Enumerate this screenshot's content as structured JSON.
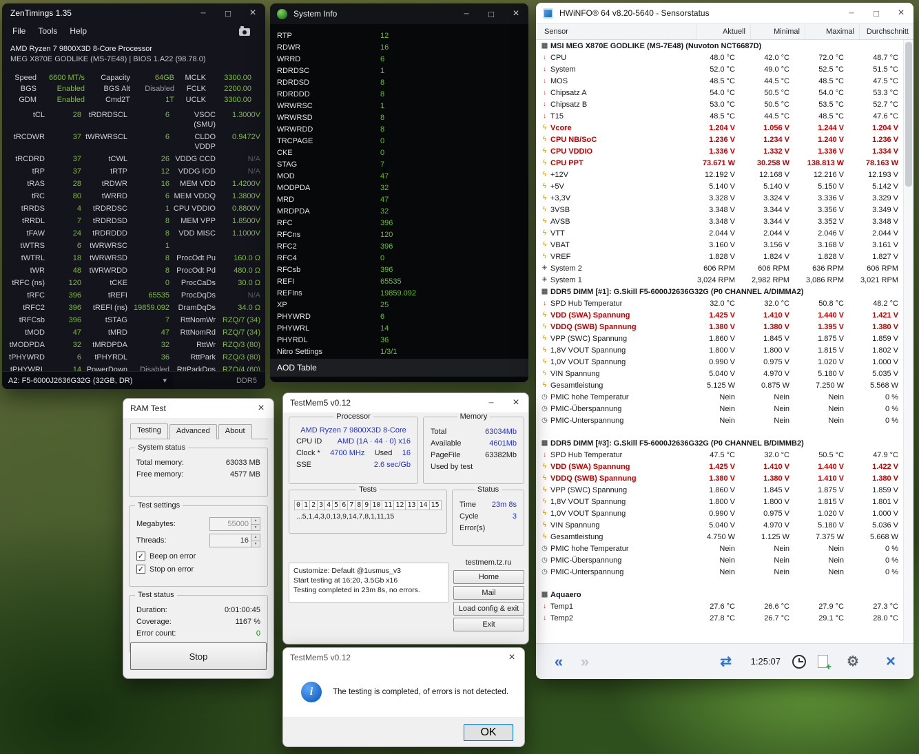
{
  "colors": {
    "zt_green": "#7dbf3a",
    "si_green": "#63c028",
    "tm_blue": "#2233cc"
  },
  "zentimings": {
    "title": "ZenTimings 1.35",
    "menu": [
      "File",
      "Tools",
      "Help"
    ],
    "cpu_line1": "AMD Ryzen 7 9800X3D 8-Core Processor",
    "board_line": "MEG X870E GODLIKE (MS-7E48) | BIOS 1.A22 (98.78.0)",
    "top_rows": [
      {
        "l1": "Speed",
        "v1": "6600 MT/s",
        "l2": "Capacity",
        "v2": "64GB",
        "l3": "MCLK",
        "v3": "3300.00"
      },
      {
        "l1": "BGS",
        "v1": "Enabled",
        "l2": "BGS Alt",
        "v2": "Disabled",
        "c2": "gray",
        "l3": "FCLK",
        "v3": "2200.00"
      },
      {
        "l1": "GDM",
        "v1": "Enabled",
        "l2": "Cmd2T",
        "v2": "1T",
        "l3": "UCLK",
        "v3": "3300.00"
      }
    ],
    "rows": [
      {
        "l1": "tCL",
        "v1": "28",
        "l2": "tRDRDSCL",
        "v2": "6",
        "l3": "VSOC (SMU)",
        "v3": "1.3000V"
      },
      {
        "l1": "tRCDWR",
        "v1": "37",
        "l2": "tWRWRSCL",
        "v2": "6",
        "l3": "CLDO VDDP",
        "v3": "0.9472V"
      },
      {
        "l1": "tRCDRD",
        "v1": "37",
        "l2": "tCWL",
        "v2": "26",
        "l3": "VDDG CCD",
        "v3": "N/A",
        "c3": "na"
      },
      {
        "l1": "tRP",
        "v1": "37",
        "l2": "tRTP",
        "v2": "12",
        "l3": "VDDG IOD",
        "v3": "N/A",
        "c3": "na"
      },
      {
        "l1": "tRAS",
        "v1": "28",
        "l2": "tRDWR",
        "v2": "16",
        "l3": "MEM VDD",
        "v3": "1.4200V"
      },
      {
        "l1": "tRC",
        "v1": "80",
        "l2": "tWRRD",
        "v2": "6",
        "l3": "MEM VDDQ",
        "v3": "1.3800V"
      },
      {
        "l1": "tRRDS",
        "v1": "4",
        "l2": "tRDRDSC",
        "v2": "1",
        "l3": "CPU VDDIO",
        "v3": "0.8800V"
      },
      {
        "l1": "tRRDL",
        "v1": "7",
        "l2": "tRDRDSD",
        "v2": "8",
        "l3": "MEM VPP",
        "v3": "1.8500V"
      },
      {
        "l1": "tFAW",
        "v1": "24",
        "l2": "tRDRDDD",
        "v2": "8",
        "l3": "VDD MISC",
        "v3": "1.1000V"
      },
      {
        "l1": "tWTRS",
        "v1": "6",
        "l2": "tWRWRSC",
        "v2": "1",
        "l3": "",
        "v3": ""
      },
      {
        "l1": "tWTRL",
        "v1": "18",
        "l2": "tWRWRSD",
        "v2": "8",
        "l3": "ProcOdt Pu",
        "v3": "160.0 Ω"
      },
      {
        "l1": "tWR",
        "v1": "48",
        "l2": "tWRWRDD",
        "v2": "8",
        "l3": "ProcOdt Pd",
        "v3": "480.0 Ω"
      },
      {
        "l1": "tRFC (ns)",
        "v1": "120",
        "l2": "tCKE",
        "v2": "0",
        "l3": "ProcCaDs",
        "v3": "30.0 Ω"
      },
      {
        "l1": "tRFC",
        "v1": "396",
        "l2": "tREFI",
        "v2": "65535",
        "l3": "ProcDqDs",
        "v3": "N/A",
        "c3": "na"
      },
      {
        "l1": "tRFC2",
        "v1": "396",
        "l2": "tREFI (ns)",
        "v2": "19859.092",
        "l3": "DramDqDs",
        "v3": "34.0 Ω"
      },
      {
        "l1": "tRFCsb",
        "v1": "396",
        "l2": "tSTAG",
        "v2": "7",
        "l3": "RttNomWr",
        "v3": "RZQ/7 (34)"
      },
      {
        "l1": "tMOD",
        "v1": "47",
        "l2": "tMRD",
        "v2": "47",
        "l3": "RttNomRd",
        "v3": "RZQ/7 (34)"
      },
      {
        "l1": "tMODPDA",
        "v1": "32",
        "l2": "tMRDPDA",
        "v2": "32",
        "l3": "RttWr",
        "v3": "RZQ/3 (80)"
      },
      {
        "l1": "tPHYWRD",
        "v1": "6",
        "l2": "tPHYRDL",
        "v2": "36",
        "l3": "RttPark",
        "v3": "RZQ/3 (80)"
      },
      {
        "l1": "tPHYWRL",
        "v1": "14",
        "l2": "PowerDown",
        "v2": "Disabled",
        "c2": "gray",
        "l3": "RttParkDqs",
        "v3": "RZQ/4 (60)"
      }
    ],
    "dimm_select": "A2: F5-6000J2636G32G (32GB, DR)",
    "mem_type": "DDR5"
  },
  "systeminfo": {
    "title": "System Info",
    "rows": [
      {
        "l": "RTP",
        "v": "12"
      },
      {
        "l": "RDWR",
        "v": "16"
      },
      {
        "l": "WRRD",
        "v": "6"
      },
      {
        "l": "RDRDSC",
        "v": "1"
      },
      {
        "l": "RDRDSD",
        "v": "8"
      },
      {
        "l": "RDRDDD",
        "v": "8"
      },
      {
        "l": "WRWRSC",
        "v": "1"
      },
      {
        "l": "WRWRSD",
        "v": "8"
      },
      {
        "l": "WRWRDD",
        "v": "8"
      },
      {
        "l": "TRCPAGE",
        "v": "0"
      },
      {
        "l": "CKE",
        "v": "0"
      },
      {
        "l": "STAG",
        "v": "7"
      },
      {
        "l": "MOD",
        "v": "47"
      },
      {
        "l": "MODPDA",
        "v": "32"
      },
      {
        "l": "MRD",
        "v": "47"
      },
      {
        "l": "MRDPDA",
        "v": "32"
      },
      {
        "l": "RFC",
        "v": "396"
      },
      {
        "l": "RFCns",
        "v": "120"
      },
      {
        "l": "RFC2",
        "v": "396"
      },
      {
        "l": "RFC4",
        "v": "0"
      },
      {
        "l": "RFCsb",
        "v": "396"
      },
      {
        "l": "REFI",
        "v": "65535"
      },
      {
        "l": "REFIns",
        "v": "19859.092"
      },
      {
        "l": "XP",
        "v": "25"
      },
      {
        "l": "PHYWRD",
        "v": "6"
      },
      {
        "l": "PHYWRL",
        "v": "14"
      },
      {
        "l": "PHYRDL",
        "v": "36"
      },
      {
        "l": "Nitro Settings",
        "v": "1/3/1"
      }
    ],
    "footer": "AOD Table"
  },
  "hwinfo": {
    "title": "HWiNFO® 64 v8.20-5640 - Sensorstatus",
    "columns": {
      "sensor": "Sensor",
      "aktuell": "Aktuell",
      "minimal": "Minimal",
      "maximal": "Maximal",
      "durchschnitt": "Durchschnitt"
    },
    "clock": "1:25:07",
    "sections": [
      {
        "title": "MSI MEG X870E GODLIKE (MS-7E48) (Nuvoton NCT6687D)",
        "icon": "mb",
        "gap": false,
        "rows": [
          {
            "icon": "temp",
            "name": "CPU",
            "a": "48.0 °C",
            "mi": "42.0 °C",
            "ma": "72.0 °C",
            "av": "48.7 °C"
          },
          {
            "icon": "temp",
            "name": "System",
            "a": "52.0 °C",
            "mi": "49.0 °C",
            "ma": "52.5 °C",
            "av": "51.5 °C"
          },
          {
            "icon": "temp",
            "name": "MOS",
            "a": "48.5 °C",
            "mi": "44.5 °C",
            "ma": "48.5 °C",
            "av": "47.5 °C"
          },
          {
            "icon": "temp",
            "name": "Chipsatz A",
            "a": "54.0 °C",
            "mi": "50.5 °C",
            "ma": "54.0 °C",
            "av": "53.3 °C"
          },
          {
            "icon": "temp",
            "name": "Chipsatz B",
            "a": "53.0 °C",
            "mi": "50.5 °C",
            "ma": "53.5 °C",
            "av": "52.7 °C"
          },
          {
            "icon": "temp",
            "name": "T15",
            "a": "48.5 °C",
            "mi": "44.5 °C",
            "ma": "48.5 °C",
            "av": "47.6 °C"
          },
          {
            "icon": "volt",
            "name": "Vcore",
            "a": "1.204 V",
            "mi": "1.056 V",
            "ma": "1.244 V",
            "av": "1.204 V",
            "cls": "red"
          },
          {
            "icon": "volt",
            "name": "CPU NB/SoC",
            "a": "1.236 V",
            "mi": "1.234 V",
            "ma": "1.240 V",
            "av": "1.236 V",
            "cls": "red"
          },
          {
            "icon": "volt",
            "name": "CPU VDDIO",
            "a": "1.336 V",
            "mi": "1.332 V",
            "ma": "1.336 V",
            "av": "1.334 V",
            "cls": "red"
          },
          {
            "icon": "volt",
            "name": "CPU PPT",
            "a": "73.671 W",
            "mi": "30.258 W",
            "ma": "138.813 W",
            "av": "78.163 W",
            "cls": "red"
          },
          {
            "icon": "volt",
            "name": "+12V",
            "a": "12.192 V",
            "mi": "12.168 V",
            "ma": "12.216 V",
            "av": "12.193 V"
          },
          {
            "icon": "volt",
            "name": "+5V",
            "a": "5.140 V",
            "mi": "5.140 V",
            "ma": "5.150 V",
            "av": "5.142 V"
          },
          {
            "icon": "volt",
            "name": "+3,3V",
            "a": "3.328 V",
            "mi": "3.324 V",
            "ma": "3.336 V",
            "av": "3.329 V"
          },
          {
            "icon": "volt",
            "name": "3VSB",
            "a": "3.348 V",
            "mi": "3.344 V",
            "ma": "3.356 V",
            "av": "3.349 V"
          },
          {
            "icon": "volt",
            "name": "AVSB",
            "a": "3.348 V",
            "mi": "3.344 V",
            "ma": "3.352 V",
            "av": "3.348 V"
          },
          {
            "icon": "volt",
            "name": "VTT",
            "a": "2.044 V",
            "mi": "2.044 V",
            "ma": "2.046 V",
            "av": "2.044 V"
          },
          {
            "icon": "volt",
            "name": "VBAT",
            "a": "3.160 V",
            "mi": "3.156 V",
            "ma": "3.168 V",
            "av": "3.161 V"
          },
          {
            "icon": "volt",
            "name": "VREF",
            "a": "1.828 V",
            "mi": "1.824 V",
            "ma": "1.828 V",
            "av": "1.827 V"
          },
          {
            "icon": "fan",
            "name": "System 2",
            "a": "606 RPM",
            "mi": "606 RPM",
            "ma": "636 RPM",
            "av": "606 RPM"
          },
          {
            "icon": "fan",
            "name": "System 1",
            "a": "3,024 RPM",
            "mi": "2,982 RPM",
            "ma": "3,086 RPM",
            "av": "3,021 RPM"
          }
        ]
      },
      {
        "title": "DDR5 DIMM [#1]: G.Skill F5-6000J2636G32G (P0 CHANNEL A/DIMMA2)",
        "icon": "mb",
        "gap": false,
        "rows": [
          {
            "icon": "temp",
            "name": "SPD Hub Temperatur",
            "a": "32.0 °C",
            "mi": "32.0 °C",
            "ma": "50.8 °C",
            "av": "48.2 °C"
          },
          {
            "icon": "volt",
            "name": "VDD (SWA) Spannung",
            "a": "1.425 V",
            "mi": "1.410 V",
            "ma": "1.440 V",
            "av": "1.421 V",
            "cls": "red"
          },
          {
            "icon": "volt",
            "name": "VDDQ (SWB) Spannung",
            "a": "1.380 V",
            "mi": "1.380 V",
            "ma": "1.395 V",
            "av": "1.380 V",
            "cls": "red"
          },
          {
            "icon": "volt",
            "name": "VPP (SWC) Spannung",
            "a": "1.860 V",
            "mi": "1.845 V",
            "ma": "1.875 V",
            "av": "1.859 V"
          },
          {
            "icon": "volt",
            "name": "1,8V VOUT Spannung",
            "a": "1.800 V",
            "mi": "1.800 V",
            "ma": "1.815 V",
            "av": "1.802 V"
          },
          {
            "icon": "volt",
            "name": "1,0V VOUT Spannung",
            "a": "0.990 V",
            "mi": "0.975 V",
            "ma": "1.020 V",
            "av": "1.000 V"
          },
          {
            "icon": "volt",
            "name": "VIN Spannung",
            "a": "5.040 V",
            "mi": "4.970 V",
            "ma": "5.180 V",
            "av": "5.035 V"
          },
          {
            "icon": "volt",
            "name": "Gesamtleistung",
            "a": "5.125 W",
            "mi": "0.875 W",
            "ma": "7.250 W",
            "av": "5.568 W"
          },
          {
            "icon": "clock",
            "name": "PMIC hohe Temperatur",
            "a": "Nein",
            "mi": "Nein",
            "ma": "Nein",
            "av": "0 %"
          },
          {
            "icon": "clock",
            "name": "PMIC-Überspannung",
            "a": "Nein",
            "mi": "Nein",
            "ma": "Nein",
            "av": "0 %"
          },
          {
            "icon": "clock",
            "name": "PMIC-Unterspannung",
            "a": "Nein",
            "mi": "Nein",
            "ma": "Nein",
            "av": "0 %"
          }
        ]
      },
      {
        "title": "DDR5 DIMM [#3]: G.Skill F5-6000J2636G32G (P0 CHANNEL B/DIMMB2)",
        "icon": "mb",
        "gap": true,
        "rows": [
          {
            "icon": "temp",
            "name": "SPD Hub Temperatur",
            "a": "47.5 °C",
            "mi": "32.0 °C",
            "ma": "50.5 °C",
            "av": "47.9 °C"
          },
          {
            "icon": "volt",
            "name": "VDD (SWA) Spannung",
            "a": "1.425 V",
            "mi": "1.410 V",
            "ma": "1.440 V",
            "av": "1.422 V",
            "cls": "red"
          },
          {
            "icon": "volt",
            "name": "VDDQ (SWB) Spannung",
            "a": "1.380 V",
            "mi": "1.380 V",
            "ma": "1.410 V",
            "av": "1.380 V",
            "cls": "red"
          },
          {
            "icon": "volt",
            "name": "VPP (SWC) Spannung",
            "a": "1.860 V",
            "mi": "1.845 V",
            "ma": "1.875 V",
            "av": "1.859 V"
          },
          {
            "icon": "volt",
            "name": "1,8V VOUT Spannung",
            "a": "1.800 V",
            "mi": "1.800 V",
            "ma": "1.815 V",
            "av": "1.801 V"
          },
          {
            "icon": "volt",
            "name": "1,0V VOUT Spannung",
            "a": "0.990 V",
            "mi": "0.975 V",
            "ma": "1.020 V",
            "av": "1.000 V"
          },
          {
            "icon": "volt",
            "name": "VIN Spannung",
            "a": "5.040 V",
            "mi": "4.970 V",
            "ma": "5.180 V",
            "av": "5.036 V"
          },
          {
            "icon": "volt",
            "name": "Gesamtleistung",
            "a": "4.750 W",
            "mi": "1.125 W",
            "ma": "7.375 W",
            "av": "5.668 W"
          },
          {
            "icon": "clock",
            "name": "PMIC hohe Temperatur",
            "a": "Nein",
            "mi": "Nein",
            "ma": "Nein",
            "av": "0 %"
          },
          {
            "icon": "clock",
            "name": "PMIC-Überspannung",
            "a": "Nein",
            "mi": "Nein",
            "ma": "Nein",
            "av": "0 %"
          },
          {
            "icon": "clock",
            "name": "PMIC-Unterspannung",
            "a": "Nein",
            "mi": "Nein",
            "ma": "Nein",
            "av": "0 %"
          }
        ]
      },
      {
        "title": "Aquaero",
        "icon": "mb",
        "gap": true,
        "rows": [
          {
            "icon": "temp",
            "name": "Temp1",
            "a": "27.6 °C",
            "mi": "26.6 °C",
            "ma": "27.9 °C",
            "av": "27.3 °C"
          },
          {
            "icon": "temp",
            "name": "Temp2",
            "a": "27.8 °C",
            "mi": "26.7 °C",
            "ma": "29.1 °C",
            "av": "28.0 °C"
          }
        ]
      }
    ]
  },
  "ramtest": {
    "title": "RAM Test",
    "tabs": [
      {
        "label": "Testing",
        "active": true
      },
      {
        "label": "Advanced",
        "active": false
      },
      {
        "label": "About",
        "active": false
      }
    ],
    "system_status": {
      "caption": "System status",
      "rows": [
        {
          "l": "Total memory:",
          "v": "63033 MB"
        },
        {
          "l": "Free memory:",
          "v": "4577 MB"
        }
      ]
    },
    "test_settings": {
      "caption": "Test settings",
      "megabytes_label": "Megabytes:",
      "megabytes_value": "55000",
      "threads_label": "Threads:",
      "threads_value": "16",
      "checkboxes": [
        {
          "label": "Beep on error",
          "checked": true
        },
        {
          "label": "Stop on error",
          "checked": true
        }
      ]
    },
    "test_status": {
      "caption": "Test status",
      "rows": [
        {
          "l": "Duration:",
          "v": "0:01:00:45"
        },
        {
          "l": "Coverage:",
          "v": "1167 %"
        },
        {
          "l": "Error count:",
          "v": "0",
          "cls": "green"
        }
      ]
    },
    "stop_label": "Stop"
  },
  "testmem5": {
    "title": "TestMem5 v0.12",
    "processor": {
      "caption": "Processor",
      "name": "AMD Ryzen 7 9800X3D 8-Core",
      "cpuid_label": "CPU ID",
      "cpuid_value": "AMD (1A · 44 · 0) x16",
      "clock_label": "Clock *",
      "clock_value": "4700 MHz",
      "used_label": "Used",
      "used_value": "16",
      "sse_label": "SSE",
      "sse_value": "2.6 sec/Gb"
    },
    "memory": {
      "caption": "Memory",
      "rows": [
        {
          "l": "Total",
          "v": "63034Mb",
          "blue": true
        },
        {
          "l": "Available",
          "v": "4601Mb",
          "blue": true
        },
        {
          "l": "PageFile",
          "v": "63382Mb",
          "blue": false
        },
        {
          "l": "Used by test",
          "v": "",
          "blue": false
        }
      ]
    },
    "tests": {
      "caption": "Tests",
      "numbers": [
        "0",
        "1",
        "2",
        "3",
        "4",
        "5",
        "6",
        "7",
        "8",
        "9",
        "10",
        "11",
        "12",
        "13",
        "14",
        "15"
      ],
      "sequence": "...5,1,4,3,0,13,9,14,7,8,1,11,15"
    },
    "status": {
      "caption": "Status",
      "rows": [
        {
          "l": "Time",
          "v": "23m 8s"
        },
        {
          "l": "Cycle",
          "v": "3"
        },
        {
          "l": "Error(s)",
          "v": ""
        }
      ]
    },
    "log_lines": [
      "Customize: Default @1usmus_v3",
      "Start testing at 16:20, 3.5Gb x16",
      "Testing completed in 23m 8s, no errors."
    ],
    "site": "testmem.tz.ru",
    "buttons": [
      "Home",
      "Mail",
      "Load config & exit",
      "Exit"
    ]
  },
  "dialog": {
    "title": "TestMem5 v0.12",
    "message": "The testing is completed, of errors is not detected.",
    "ok_label": "OK"
  }
}
